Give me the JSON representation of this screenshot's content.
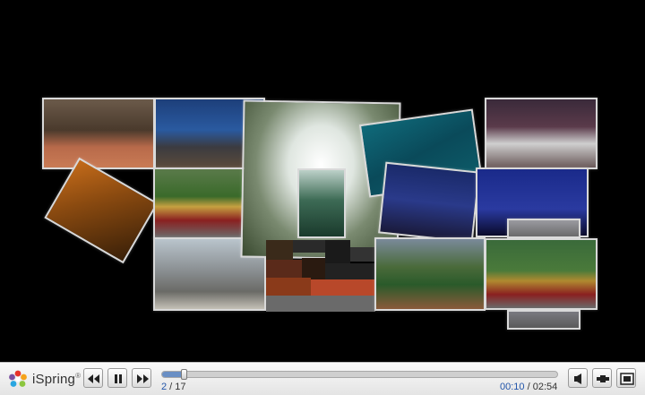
{
  "player": {
    "brand": "iSpring",
    "brand_mark": "®",
    "slide_current": "2",
    "slide_separator": " / ",
    "slide_total": "17",
    "time_current": "00:10",
    "time_separator": " / ",
    "time_total": "02:54",
    "progress_fraction": 0.054,
    "accent_color": "#2255aa"
  },
  "buttons": {
    "prev": "previous-icon",
    "pause": "pause-icon",
    "next": "next-icon",
    "volume": "volume-icon",
    "playlist": "playlist-icon",
    "fullscreen": "fullscreen-icon"
  }
}
